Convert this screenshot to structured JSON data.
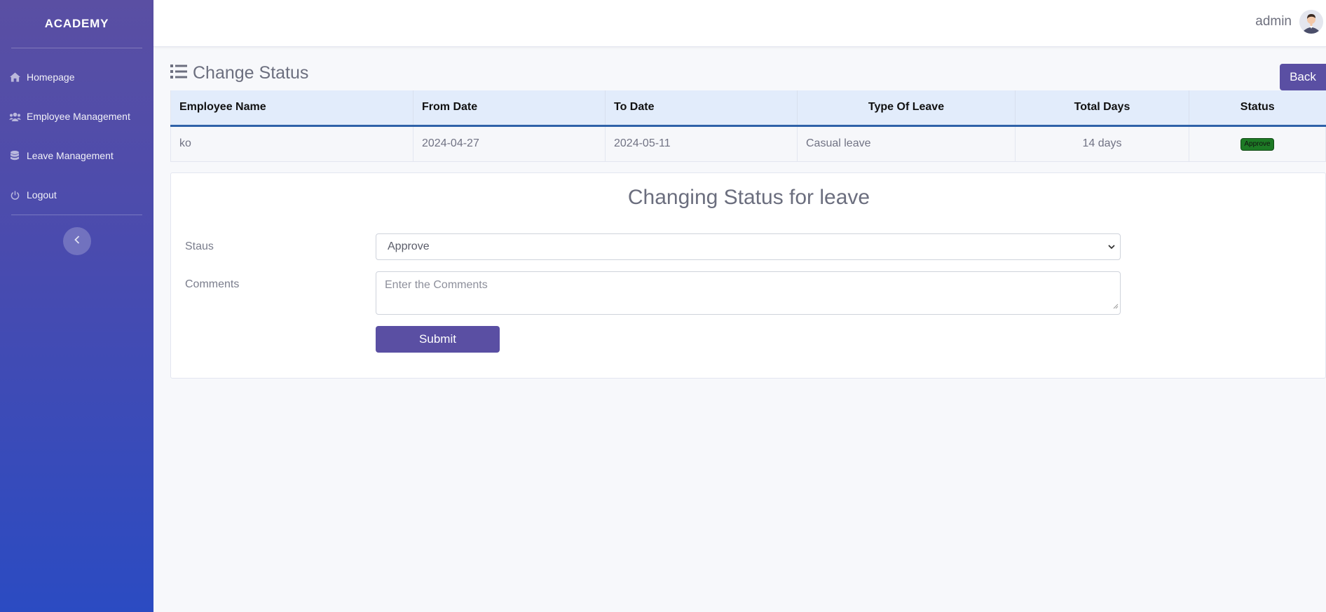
{
  "sidebar": {
    "brand": "ACADEMY",
    "items": [
      {
        "label": "Homepage",
        "icon": "home-icon"
      },
      {
        "label": "Employee Management",
        "icon": "users-icon"
      },
      {
        "label": "Leave Management",
        "icon": "database-icon"
      },
      {
        "label": "Logout",
        "icon": "power-icon"
      }
    ],
    "toggle_icon": "chevron-left-icon"
  },
  "topbar": {
    "username": "admin",
    "avatar_icon": "user-avatar-icon"
  },
  "page": {
    "title": "Change Status",
    "title_icon": "list-icon",
    "back_label": "Back"
  },
  "table": {
    "headers": [
      "Employee Name",
      "From Date",
      "To Date",
      "Type Of Leave",
      "Total Days",
      "Status"
    ],
    "rows": [
      {
        "employee": "ko",
        "from": "2024-04-27",
        "to": "2024-05-11",
        "type": "Casual leave",
        "days": "14 days",
        "status": "Approve"
      }
    ]
  },
  "form": {
    "title": "Changing Status for leave",
    "status_label": "Staus",
    "status_value": "Approve",
    "comments_label": "Comments",
    "comments_placeholder": "Enter the Comments",
    "submit_label": "Submit"
  },
  "colors": {
    "accent": "#5a4fa3",
    "header_border": "#2f62a8",
    "badge": "#1d7a25"
  }
}
